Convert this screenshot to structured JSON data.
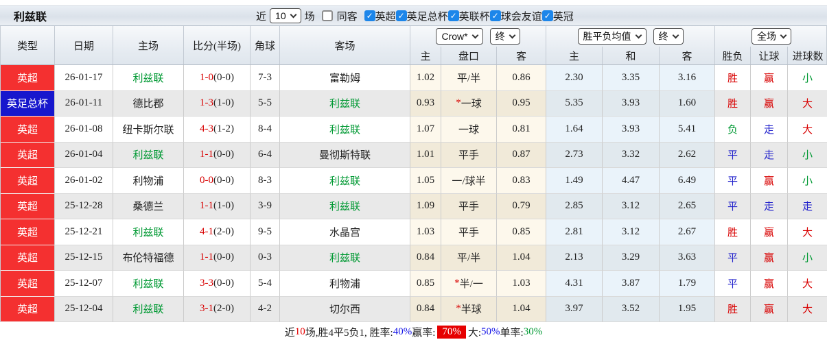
{
  "title": "利兹联",
  "filter_bar": {
    "recent_label": "近",
    "recent_select": "10",
    "matches_label": "场",
    "checkboxes": [
      {
        "label": "同客",
        "checked": false
      },
      {
        "label": "英超",
        "checked": true
      },
      {
        "label": "英足总杯",
        "checked": true
      },
      {
        "label": "英联杯",
        "checked": true
      },
      {
        "label": "球会友谊",
        "checked": true
      },
      {
        "label": "英冠",
        "checked": true
      }
    ]
  },
  "header": {
    "left_columns": [
      "类型",
      "日期",
      "主场",
      "比分(半场)",
      "角球",
      "客场"
    ],
    "odds_group": {
      "selects": [
        "Crow*",
        "终"
      ],
      "columns": [
        "主",
        "盘口",
        "客"
      ]
    },
    "avg_group": {
      "selects": [
        "胜平负均值",
        "终"
      ],
      "columns": [
        "主",
        "和",
        "客"
      ]
    },
    "result_group": {
      "selects": [
        "全场"
      ],
      "columns": [
        "胜负",
        "让球",
        "进球数"
      ]
    }
  },
  "rows": [
    {
      "league": "英超",
      "league_bg": "red",
      "date": "26-01-17",
      "home": "利兹联",
      "home_highlight": true,
      "score": "1-0",
      "half": "(0-0)",
      "corner": "7-3",
      "away": "富勒姆",
      "away_highlight": false,
      "crow_home": "1.02",
      "star": "",
      "handicap": "平/半",
      "crow_away": "0.86",
      "avg_win": "2.30",
      "avg_draw": "3.35",
      "avg_lose": "3.16",
      "wdl": "胜",
      "wdl_color": "red",
      "spread": "赢",
      "spread_color": "red",
      "goals": "小",
      "goals_color": "green"
    },
    {
      "league": "英足总杯",
      "league_bg": "blue",
      "date": "26-01-11",
      "home": "德比郡",
      "home_highlight": false,
      "score": "1-3",
      "half": "(1-0)",
      "corner": "5-5",
      "away": "利兹联",
      "away_highlight": true,
      "crow_home": "0.93",
      "star": "*",
      "handicap": "一球",
      "crow_away": "0.95",
      "avg_win": "5.35",
      "avg_draw": "3.93",
      "avg_lose": "1.60",
      "wdl": "胜",
      "wdl_color": "red",
      "spread": "赢",
      "spread_color": "red",
      "goals": "大",
      "goals_color": "red"
    },
    {
      "league": "英超",
      "league_bg": "red",
      "date": "26-01-08",
      "home": "纽卡斯尔联",
      "home_highlight": false,
      "score": "4-3",
      "half": "(1-2)",
      "corner": "8-4",
      "away": "利兹联",
      "away_highlight": true,
      "crow_home": "1.07",
      "star": "",
      "handicap": "一球",
      "crow_away": "0.81",
      "avg_win": "1.64",
      "avg_draw": "3.93",
      "avg_lose": "5.41",
      "wdl": "负",
      "wdl_color": "green",
      "spread": "走",
      "spread_color": "blue",
      "goals": "大",
      "goals_color": "red"
    },
    {
      "league": "英超",
      "league_bg": "red",
      "date": "26-01-04",
      "home": "利兹联",
      "home_highlight": true,
      "score": "1-1",
      "half": "(0-0)",
      "corner": "6-4",
      "away": "曼彻斯特联",
      "away_highlight": false,
      "crow_home": "1.01",
      "star": "",
      "handicap": "平手",
      "crow_away": "0.87",
      "avg_win": "2.73",
      "avg_draw": "3.32",
      "avg_lose": "2.62",
      "wdl": "平",
      "wdl_color": "blue",
      "spread": "走",
      "spread_color": "blue",
      "goals": "小",
      "goals_color": "green"
    },
    {
      "league": "英超",
      "league_bg": "red",
      "date": "26-01-02",
      "home": "利物浦",
      "home_highlight": false,
      "score": "0-0",
      "half": "(0-0)",
      "corner": "8-3",
      "away": "利兹联",
      "away_highlight": true,
      "crow_home": "1.05",
      "star": "",
      "handicap": "一/球半",
      "crow_away": "0.83",
      "avg_win": "1.49",
      "avg_draw": "4.47",
      "avg_lose": "6.49",
      "wdl": "平",
      "wdl_color": "blue",
      "spread": "赢",
      "spread_color": "red",
      "goals": "小",
      "goals_color": "green"
    },
    {
      "league": "英超",
      "league_bg": "red",
      "date": "25-12-28",
      "home": "桑德兰",
      "home_highlight": false,
      "score": "1-1",
      "half": "(1-0)",
      "corner": "3-9",
      "away": "利兹联",
      "away_highlight": true,
      "crow_home": "1.09",
      "star": "",
      "handicap": "平手",
      "crow_away": "0.79",
      "avg_win": "2.85",
      "avg_draw": "3.12",
      "avg_lose": "2.65",
      "wdl": "平",
      "wdl_color": "blue",
      "spread": "走",
      "spread_color": "blue",
      "goals": "走",
      "goals_color": "blue"
    },
    {
      "league": "英超",
      "league_bg": "red",
      "date": "25-12-21",
      "home": "利兹联",
      "home_highlight": true,
      "score": "4-1",
      "half": "(2-0)",
      "corner": "9-5",
      "away": "水晶宫",
      "away_highlight": false,
      "crow_home": "1.03",
      "star": "",
      "handicap": "平手",
      "crow_away": "0.85",
      "avg_win": "2.81",
      "avg_draw": "3.12",
      "avg_lose": "2.67",
      "wdl": "胜",
      "wdl_color": "red",
      "spread": "赢",
      "spread_color": "red",
      "goals": "大",
      "goals_color": "red"
    },
    {
      "league": "英超",
      "league_bg": "red",
      "date": "25-12-15",
      "home": "布伦特福德",
      "home_highlight": false,
      "score": "1-1",
      "half": "(0-0)",
      "corner": "0-3",
      "away": "利兹联",
      "away_highlight": true,
      "crow_home": "0.84",
      "star": "",
      "handicap": "平/半",
      "crow_away": "1.04",
      "avg_win": "2.13",
      "avg_draw": "3.29",
      "avg_lose": "3.63",
      "wdl": "平",
      "wdl_color": "blue",
      "spread": "赢",
      "spread_color": "red",
      "goals": "小",
      "goals_color": "green"
    },
    {
      "league": "英超",
      "league_bg": "red",
      "date": "25-12-07",
      "home": "利兹联",
      "home_highlight": true,
      "score": "3-3",
      "half": "(0-0)",
      "corner": "5-4",
      "away": "利物浦",
      "away_highlight": false,
      "crow_home": "0.85",
      "star": "*",
      "handicap": "半/一",
      "crow_away": "1.03",
      "avg_win": "4.31",
      "avg_draw": "3.87",
      "avg_lose": "1.79",
      "wdl": "平",
      "wdl_color": "blue",
      "spread": "赢",
      "spread_color": "red",
      "goals": "大",
      "goals_color": "red"
    },
    {
      "league": "英超",
      "league_bg": "red",
      "date": "25-12-04",
      "home": "利兹联",
      "home_highlight": true,
      "score": "3-1",
      "half": "(2-0)",
      "corner": "4-2",
      "away": "切尔西",
      "away_highlight": false,
      "crow_home": "0.84",
      "star": "*",
      "handicap": "半球",
      "crow_away": "1.04",
      "avg_win": "3.97",
      "avg_draw": "3.52",
      "avg_lose": "1.95",
      "wdl": "胜",
      "wdl_color": "red",
      "spread": "赢",
      "spread_color": "red",
      "goals": "大",
      "goals_color": "red"
    }
  ],
  "footer": {
    "parts": [
      {
        "text": "近",
        "color": "black"
      },
      {
        "text": "10",
        "color": "red"
      },
      {
        "text": "场,胜4平5负1, 胜率:",
        "color": "black"
      },
      {
        "text": "40%",
        "color": "blue"
      },
      {
        "text": " 赢率:",
        "color": "black"
      },
      {
        "text": "70%",
        "color": "white",
        "bg": "red"
      },
      {
        "text": "大:",
        "color": "black"
      },
      {
        "text": "50%",
        "color": "blue"
      },
      {
        "text": " 单率:",
        "color": "black"
      },
      {
        "text": "30%",
        "color": "green"
      }
    ]
  },
  "colors": {
    "badge_red": "#f43030",
    "badge_blue": "#1717cd",
    "text_red": "#d80000",
    "text_blue": "#2222cc",
    "text_green": "#009933",
    "checkbox_blue": "#1c86ea",
    "stripe_grey": "#e9e9e9",
    "odds_cream": "#fdf8ec",
    "avg_blue": "#eaf3fa"
  }
}
